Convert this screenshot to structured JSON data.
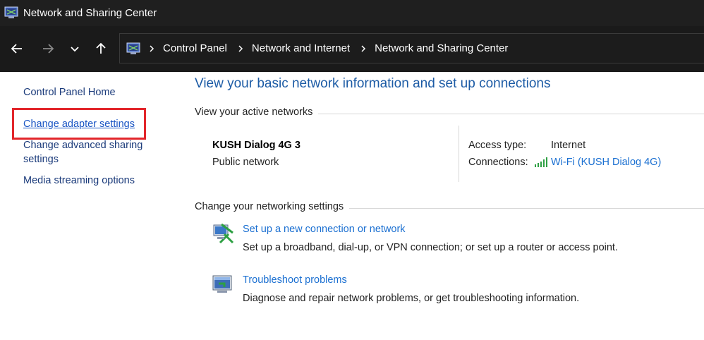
{
  "window": {
    "title": "Network and Sharing Center"
  },
  "breadcrumb": [
    "Control Panel",
    "Network and Internet",
    "Network and Sharing Center"
  ],
  "left_pane": {
    "home": "Control Panel Home",
    "items": [
      "Change adapter settings",
      "Change advanced sharing settings",
      "Media streaming options"
    ]
  },
  "main": {
    "heading": "View your basic network information and set up connections",
    "active_networks_label": "View your active networks",
    "network": {
      "name": "KUSH Dialog 4G 3",
      "category": "Public network",
      "access_type_label": "Access type:",
      "access_type_value": "Internet",
      "connections_label": "Connections:",
      "connections_value": "Wi-Fi (KUSH Dialog 4G)"
    },
    "change_settings_label": "Change your networking settings",
    "tasks": [
      {
        "link": "Set up a new connection or network",
        "desc": "Set up a broadband, dial-up, or VPN connection; or set up a router or access point.",
        "icon": "network-setup-icon"
      },
      {
        "link": "Troubleshoot problems",
        "desc": "Diagnose and repair network problems, or get troubleshooting information.",
        "icon": "troubleshoot-icon"
      }
    ]
  },
  "colors": {
    "title_bg": "#1f1f1f",
    "link": "#1a6fd1",
    "heading": "#1c5ba5",
    "highlight": "#e2262b"
  }
}
